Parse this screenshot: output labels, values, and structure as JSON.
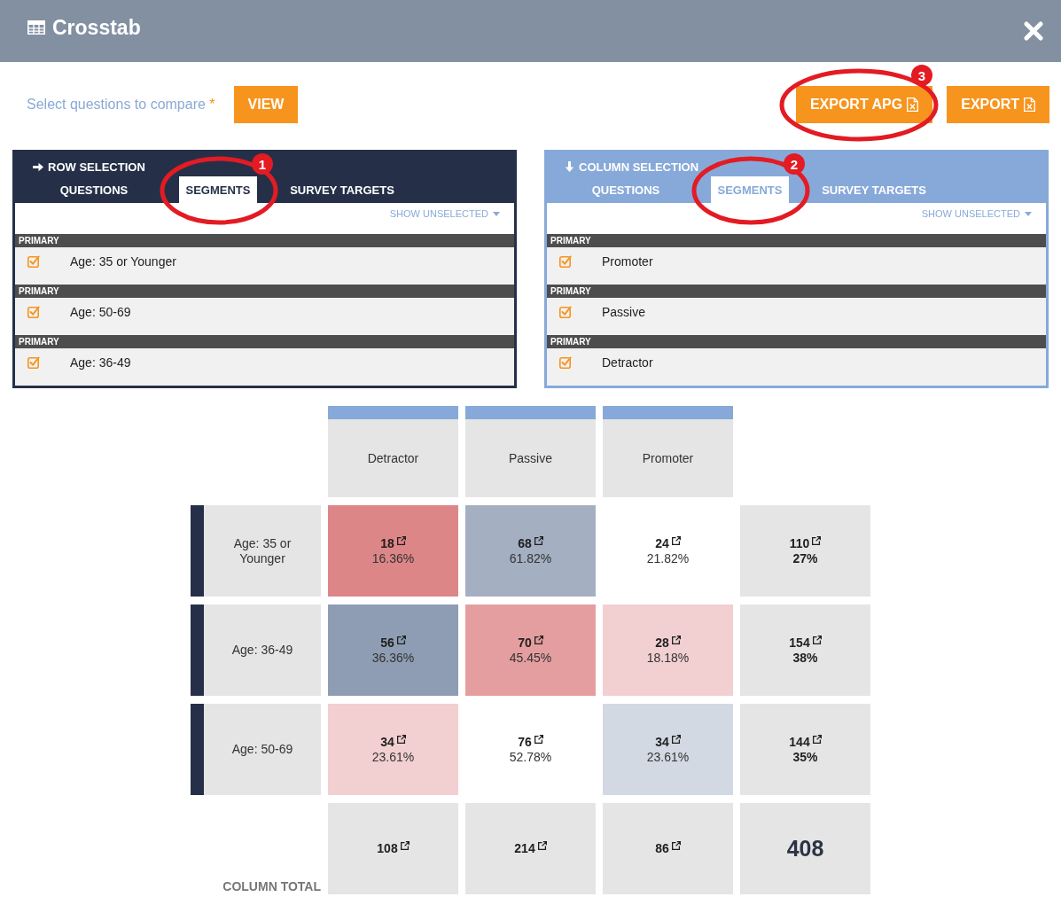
{
  "window": {
    "title": "Crosstab"
  },
  "toolbar": {
    "prompt": "Select questions to compare",
    "required_mark": "*",
    "view_button": "VIEW",
    "export_buttons": [
      {
        "label": "EXPORT APG",
        "callout": "3"
      },
      {
        "label": "EXPORT"
      }
    ]
  },
  "selection_panels": [
    {
      "kind": "row",
      "title": "ROW SELECTION",
      "tabs": [
        {
          "label": "QUESTIONS",
          "selected": false
        },
        {
          "label": "SEGMENTS",
          "selected": true,
          "callout": "1"
        },
        {
          "label": "SURVEY TARGETS",
          "selected": false
        }
      ],
      "filter": "SHOW UNSELECTED",
      "groups": [
        {
          "heading": "PRIMARY",
          "items": [
            {
              "label": "Age: 35 or Younger",
              "checked": true
            }
          ]
        },
        {
          "heading": "PRIMARY",
          "items": [
            {
              "label": "Age: 50-69",
              "checked": true
            }
          ]
        },
        {
          "heading": "PRIMARY",
          "items": [
            {
              "label": "Age: 36-49",
              "checked": true
            }
          ]
        }
      ]
    },
    {
      "kind": "column",
      "title": "COLUMN SELECTION",
      "tabs": [
        {
          "label": "QUESTIONS",
          "selected": false
        },
        {
          "label": "SEGMENTS",
          "selected": true,
          "callout": "2"
        },
        {
          "label": "SURVEY TARGETS",
          "selected": false
        }
      ],
      "filter": "SHOW UNSELECTED",
      "groups": [
        {
          "heading": "PRIMARY",
          "items": [
            {
              "label": "Promoter",
              "checked": true
            }
          ]
        },
        {
          "heading": "PRIMARY",
          "items": [
            {
              "label": "Passive",
              "checked": true
            }
          ]
        },
        {
          "heading": "PRIMARY",
          "items": [
            {
              "label": "Detractor",
              "checked": true
            }
          ]
        }
      ]
    }
  ],
  "crosstab": {
    "columns": [
      "Detractor",
      "Passive",
      "Promoter"
    ],
    "rows": [
      {
        "label": "Age: 35 or Younger",
        "cells": [
          {
            "count": "18",
            "percent": "16.36%",
            "color": "#dd8688"
          },
          {
            "count": "68",
            "percent": "61.82%",
            "color": "#a4afc2"
          },
          {
            "count": "24",
            "percent": "21.82%",
            "color": "#ffffff"
          }
        ],
        "total": {
          "count": "110",
          "percent": "27%"
        }
      },
      {
        "label": "Age: 36-49",
        "cells": [
          {
            "count": "56",
            "percent": "36.36%",
            "color": "#8e9db3"
          },
          {
            "count": "70",
            "percent": "45.45%",
            "color": "#e49e9f"
          },
          {
            "count": "28",
            "percent": "18.18%",
            "color": "#f2cfd1"
          }
        ],
        "total": {
          "count": "154",
          "percent": "38%"
        }
      },
      {
        "label": "Age: 50-69",
        "cells": [
          {
            "count": "34",
            "percent": "23.61%",
            "color": "#f2cfd1"
          },
          {
            "count": "76",
            "percent": "52.78%",
            "color": "#ffffff"
          },
          {
            "count": "34",
            "percent": "23.61%",
            "color": "#d2d9e3"
          }
        ],
        "total": {
          "count": "144",
          "percent": "35%"
        }
      }
    ],
    "column_total": {
      "label": "COLUMN TOTAL",
      "counts": [
        "108",
        "214",
        "86"
      ],
      "grand_total": "408"
    }
  }
}
